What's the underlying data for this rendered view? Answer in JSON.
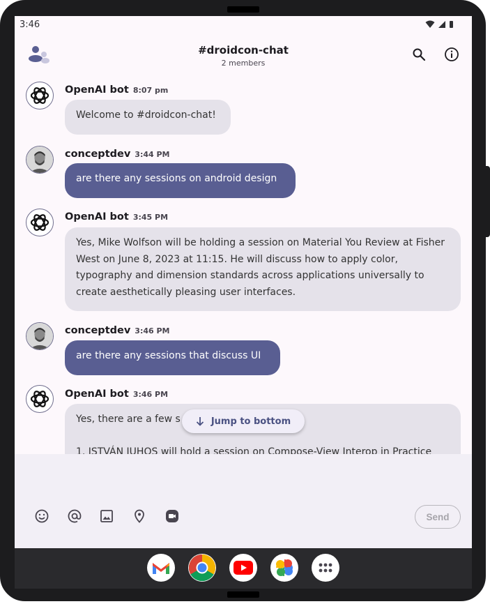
{
  "status_bar": {
    "time": "3:46"
  },
  "header": {
    "title": "#droidcon-chat",
    "subtitle": "2 members",
    "icons": [
      "stream-logo-icon",
      "search-icon",
      "info-icon"
    ]
  },
  "messages": [
    {
      "sender": "OpenAI bot",
      "time": "8:07 pm",
      "type": "bot",
      "text": "Welcome to #droidcon-chat!"
    },
    {
      "sender": "conceptdev",
      "time": "3:44 PM",
      "type": "user",
      "text": "are there any sessions on android design"
    },
    {
      "sender": "OpenAI bot",
      "time": "3:45 PM",
      "type": "bot",
      "text": "Yes, Mike Wolfson will be holding a session on Material You Review at Fisher West on June 8, 2023 at 11:15. He will discuss how to apply color, typography and dimension standards across applications universally to create aesthetically pleasing user interfaces."
    },
    {
      "sender": "conceptdev",
      "time": "3:46 PM",
      "type": "user",
      "text": "are there any sessions that discuss UI"
    },
    {
      "sender": "OpenAI bot",
      "time": "3:46 PM",
      "type": "bot",
      "text": "Yes, there are a few s\n\n1. ISTVÁN JUHOS will hold a session on Compose-View Interop in Practice"
    }
  ],
  "jump_to_bottom": {
    "label": "Jump to bottom"
  },
  "composer": {
    "input_value": "",
    "input_placeholder": "",
    "send_label": "Send",
    "tools": [
      "emoji-icon",
      "mention-icon",
      "image-icon",
      "location-icon",
      "video-call-icon"
    ]
  },
  "dock": [
    "gmail-app-icon",
    "chrome-app-icon",
    "youtube-app-icon",
    "photos-app-icon",
    "app-drawer-icon"
  ],
  "colors": {
    "user_bubble": "#595e92",
    "bot_bubble": "#e5e2ea",
    "screen_background": "#fdf8fc",
    "composer_background": "#f2eff6"
  }
}
